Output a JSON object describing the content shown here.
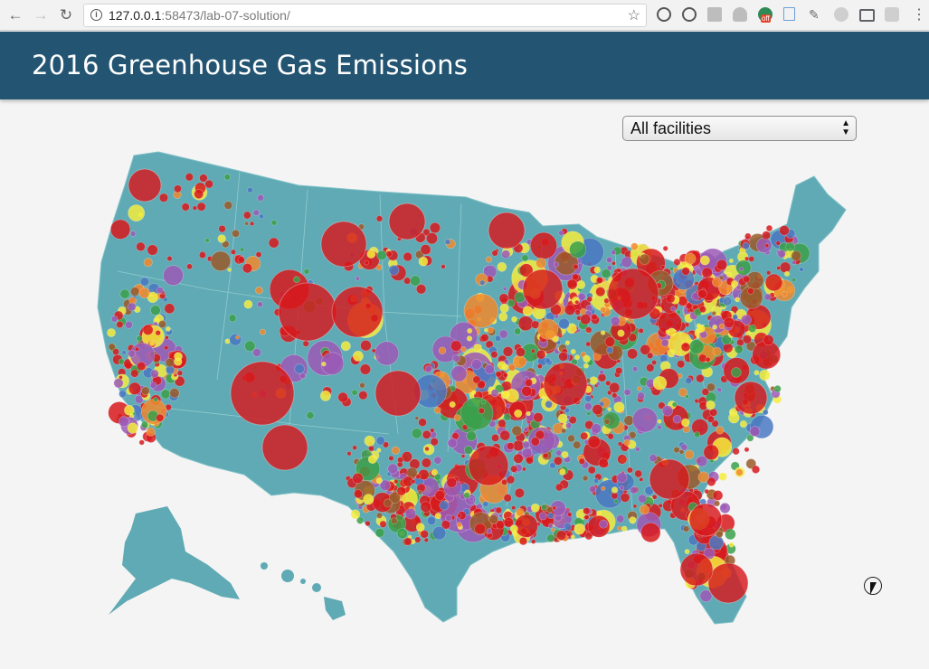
{
  "browser": {
    "url_host": "127.0.0.1",
    "url_rest": ":58473/lab-07-solution/",
    "extension_badge": "off"
  },
  "app": {
    "title": "2016 Greenhouse Gas Emissions"
  },
  "filter": {
    "selected": "All facilities"
  },
  "colors": {
    "header_bg": "#235573",
    "land": "#5faab4",
    "page_bg": "#f4f4f4",
    "red": "#d7191c",
    "orange": "#f08a2e",
    "yellow": "#f5ec3c",
    "purple": "#9b59b6",
    "green": "#3aa04a",
    "blue": "#4a78c2",
    "brown": "#9a5a2a"
  }
}
